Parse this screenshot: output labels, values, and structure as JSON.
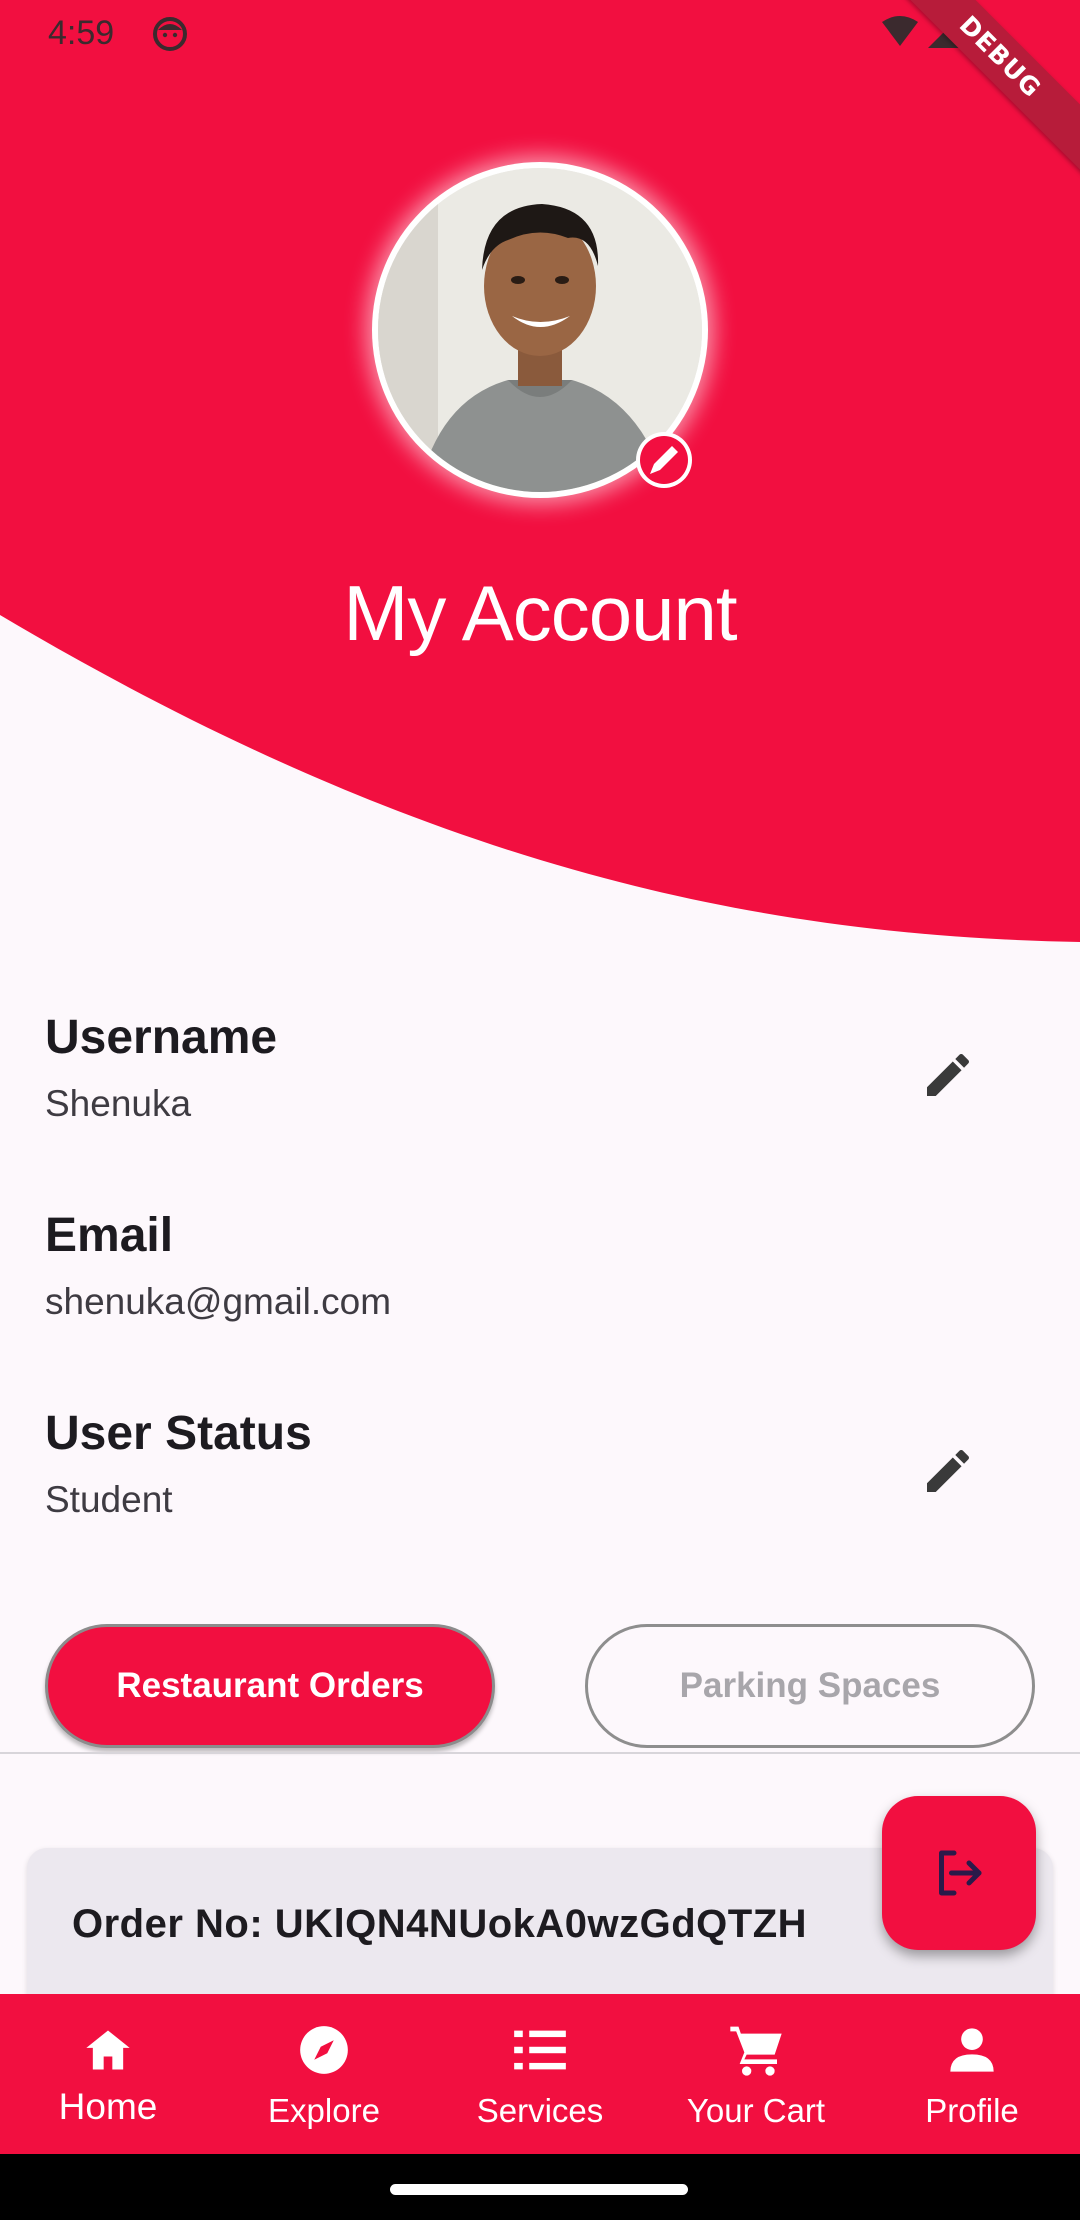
{
  "status_bar": {
    "time": "4:59",
    "debug_label": "DEBUG"
  },
  "colors": {
    "primary": "#f20f40",
    "background": "#fdf8fc",
    "card": "#ece8ef"
  },
  "header": {
    "title": "My Account"
  },
  "profile": {
    "fields": [
      {
        "label": "Username",
        "value": "Shenuka",
        "editable": true
      },
      {
        "label": "Email",
        "value": "shenuka@gmail.com",
        "editable": false
      },
      {
        "label": "User Status",
        "value": "Student",
        "editable": true
      }
    ]
  },
  "tabs": [
    {
      "label": "Restaurant Orders",
      "selected": true
    },
    {
      "label": "Parking Spaces",
      "selected": false
    }
  ],
  "orders": [
    {
      "text": "Order No: UKlQN4NUokA0wzGdQTZH"
    }
  ],
  "fab": {
    "icon": "logout-icon"
  },
  "bottom_nav": [
    {
      "label": "Home",
      "icon": "home-icon",
      "active": true
    },
    {
      "label": "Explore",
      "icon": "compass-icon",
      "active": false
    },
    {
      "label": "Services",
      "icon": "list-icon",
      "active": false
    },
    {
      "label": "Your Cart",
      "icon": "cart-icon",
      "active": false
    },
    {
      "label": "Profile",
      "icon": "person-icon",
      "active": false
    }
  ]
}
